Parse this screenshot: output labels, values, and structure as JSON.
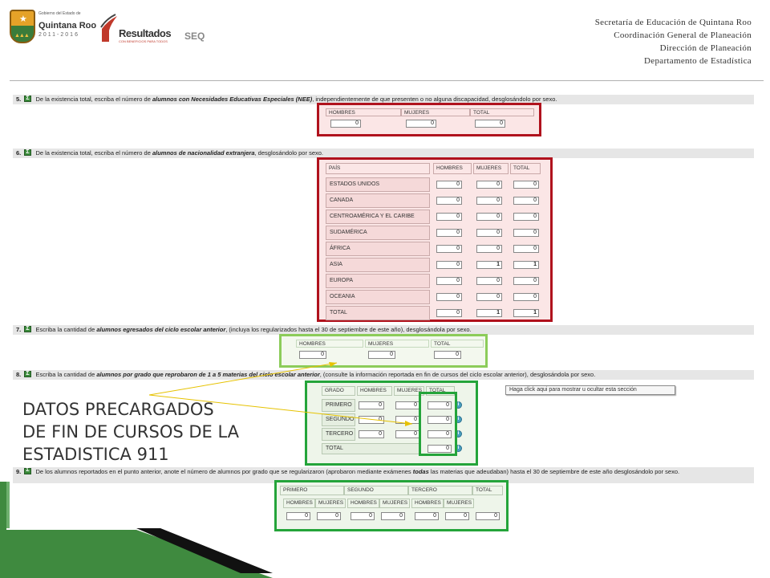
{
  "header": {
    "logo_gov_small": "Gobierno del Estado de",
    "logo_gov_name": "Quintana Roo",
    "logo_years": "2011-2016",
    "logo_res_word": "Resultados",
    "logo_res_sub": "CON BENEFICIOS PARA TODOS",
    "logo_seq": "SEQ",
    "org_lines": [
      "Secretaría de Educación de Quintana Roo",
      "Coordinación General de Planeación",
      "Dirección de Planeación",
      "Departamento de Estadística"
    ]
  },
  "colors": {
    "red_frame": "#b0121d",
    "green_frame": "#24a43a",
    "lime_frame": "#8ccc5a"
  },
  "q5": {
    "num": "5.",
    "text_pre": "De la existencia total, escriba el número de",
    "text_bold": "alumnos con Necesidades Educativas Especiales (NEE)",
    "text_post": ", independientemente de que presenten o no alguna discapacidad, desglosándolo por sexo.",
    "headers": [
      "HOMBRES",
      "MUJERES",
      "TOTAL"
    ],
    "values": [
      "0",
      "0",
      "0"
    ]
  },
  "q6": {
    "num": "6.",
    "text_pre": "De la existencia total, escriba el número de",
    "text_bold": "alumnos de nacionalidad extranjera",
    "text_post": ", desglosándolo por sexo.",
    "headers": [
      "PAÍS",
      "HOMBRES",
      "MUJERES",
      "TOTAL"
    ],
    "rows": [
      {
        "pais": "ESTADOS UNIDOS",
        "hombres": "0",
        "mujeres": "0",
        "total": "0"
      },
      {
        "pais": "CANADA",
        "hombres": "0",
        "mujeres": "0",
        "total": "0"
      },
      {
        "pais": "CENTROAMÉRICA Y EL CARIBE",
        "hombres": "0",
        "mujeres": "0",
        "total": "0"
      },
      {
        "pais": "SUDAMÉRICA",
        "hombres": "0",
        "mujeres": "0",
        "total": "0"
      },
      {
        "pais": "ÁFRICA",
        "hombres": "0",
        "mujeres": "0",
        "total": "0"
      },
      {
        "pais": "ASIA",
        "hombres": "0",
        "mujeres": "1",
        "total": "1"
      },
      {
        "pais": "EUROPA",
        "hombres": "0",
        "mujeres": "0",
        "total": "0"
      },
      {
        "pais": "OCEANIA",
        "hombres": "0",
        "mujeres": "0",
        "total": "0"
      },
      {
        "pais": "TOTAL",
        "hombres": "0",
        "mujeres": "1",
        "total": "1"
      }
    ]
  },
  "q7": {
    "num": "7.",
    "text_pre": "Escriba la cantidad de",
    "text_bold": "alumnos egresados del ciclo escolar anterior",
    "text_post": ", (incluya los regularizados hasta el 30 de septiembre de este año), desglosándola por sexo.",
    "headers": [
      "HOMBRES",
      "MUJERES",
      "TOTAL"
    ],
    "values": [
      "0",
      "0",
      "0"
    ]
  },
  "q8": {
    "num": "8.",
    "text_pre": "Escriba la cantidad de",
    "text_bold": "alumnos por grado que reprobaron de 1 a 5 materias del ciclo escolar anterior",
    "text_post": ", (consulte la información reportada en fin de cursos del ciclo escolar anterior), desglosándola por sexo.",
    "headers": [
      "GRADO",
      "HOMBRES",
      "MUJERES",
      "TOTAL"
    ],
    "rows": [
      {
        "grado": "PRIMERO",
        "hombres": "0",
        "mujeres": "0",
        "total": "0"
      },
      {
        "grado": "SEGUNDO",
        "hombres": "0",
        "mujeres": "0",
        "total": "0"
      },
      {
        "grado": "TERCERO",
        "hombres": "0",
        "mujeres": "0",
        "total": "0"
      }
    ],
    "total_label": "TOTAL",
    "total_value": "0",
    "tooltip": "Haga click aqui para mostrar u ocultar esta sección"
  },
  "q9": {
    "num": "9.",
    "text_pre": "De los alumnos reportados en el punto anterior, anote el número de alumnos por grado que se regularizaron (aprobaron mediante exámenes",
    "text_bold": "todas",
    "text_post": "las materias que adeudaban) hasta el 30 de septiembre de este año desglosándolo por sexo.",
    "groups": [
      "PRIMERO",
      "SEGUNDO",
      "TERCERO",
      "TOTAL"
    ],
    "sub": [
      "HOMBRES",
      "MUJERES"
    ],
    "values": [
      "0",
      "0",
      "0",
      "0",
      "0",
      "0",
      "0"
    ]
  },
  "callout": [
    "DATOS PRECARGADOS",
    "DE FIN DE CURSOS DE LA",
    "ESTADISTICA 911"
  ]
}
